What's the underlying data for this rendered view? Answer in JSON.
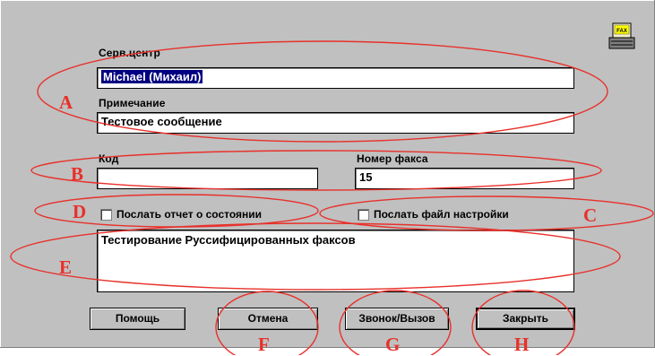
{
  "form": {
    "service_center": {
      "label": "Серв.центр",
      "value": "Michael (Михаил)"
    },
    "note": {
      "label": "Примечание",
      "value": "Тестовое сообщение"
    },
    "code": {
      "label": "Код",
      "value": ""
    },
    "fax_number": {
      "label": "Номер факса",
      "value": "15"
    },
    "send_status_report": {
      "label": "Послать отчет о состоянии",
      "checked": false
    },
    "send_config_file": {
      "label": "Послать файл настройки",
      "checked": false
    },
    "message": "Тестирование Руссифицированных факсов"
  },
  "buttons": {
    "help": "Помощь",
    "cancel": "Отмена",
    "call": "Звонок/Вызов",
    "close": "Закрыть"
  },
  "fax_icon": {
    "icon": "fax-machine-icon",
    "text": "FAX"
  },
  "annotations": [
    "A",
    "B",
    "C",
    "D",
    "E",
    "F",
    "G",
    "H"
  ],
  "colors": {
    "dialog_bg": "#c0c0c0",
    "selection": "#000080",
    "annotation": "#e8302a"
  }
}
